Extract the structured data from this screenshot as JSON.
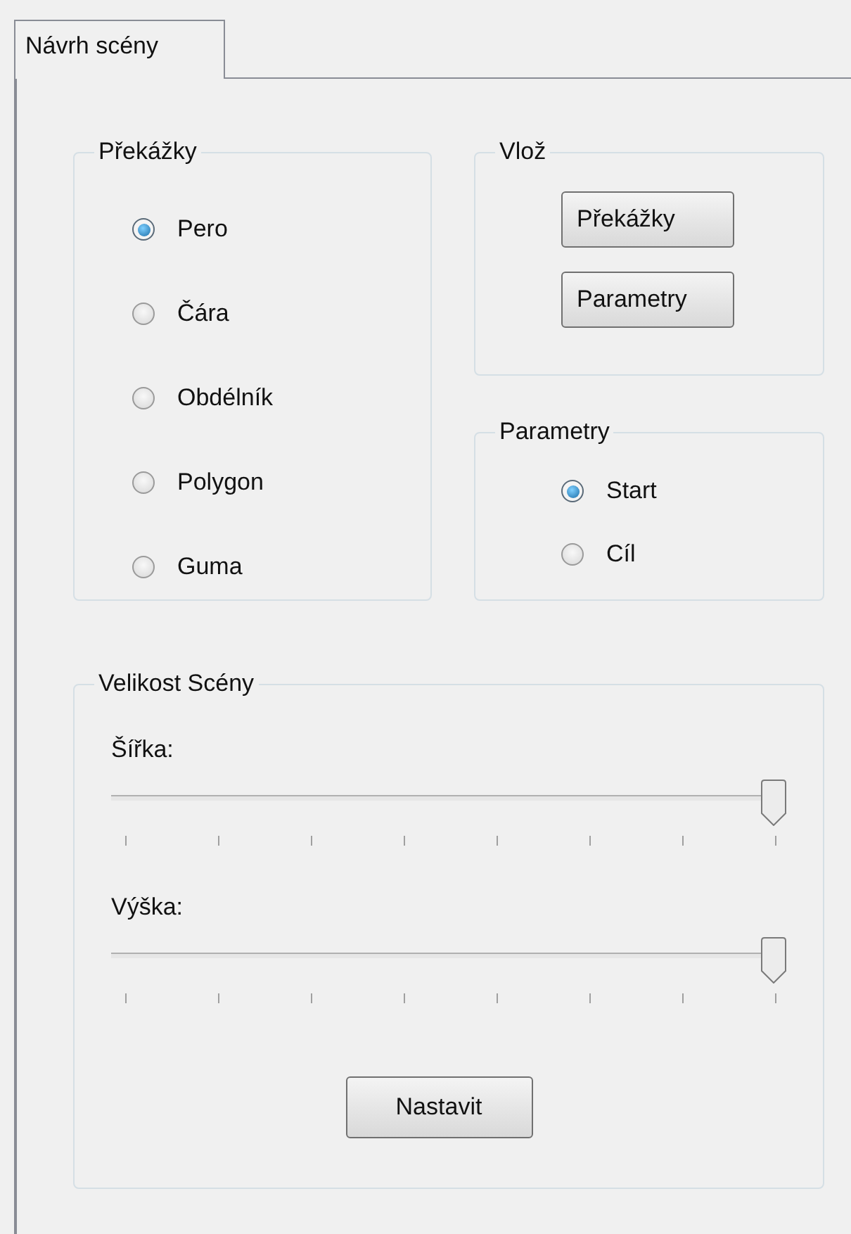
{
  "tabs": [
    {
      "label": "Návrh scény",
      "selected": true
    }
  ],
  "obstacles": {
    "title": "Překážky",
    "options": [
      {
        "label": "Pero",
        "selected": true
      },
      {
        "label": "Čára",
        "selected": false
      },
      {
        "label": "Obdélník",
        "selected": false
      },
      {
        "label": "Polygon",
        "selected": false
      },
      {
        "label": "Guma",
        "selected": false
      }
    ]
  },
  "insert": {
    "title": "Vlož",
    "buttons": [
      "Překážky",
      "Parametry"
    ]
  },
  "parameters": {
    "title": "Parametry",
    "options": [
      {
        "label": "Start",
        "selected": true
      },
      {
        "label": "Cíl",
        "selected": false
      }
    ]
  },
  "scene_size": {
    "title": "Velikost Scény",
    "sliders": [
      {
        "label": "Šířka:",
        "level": 1
      },
      {
        "label": "Výška:",
        "level": 1
      }
    ],
    "button": "Nastavit"
  }
}
